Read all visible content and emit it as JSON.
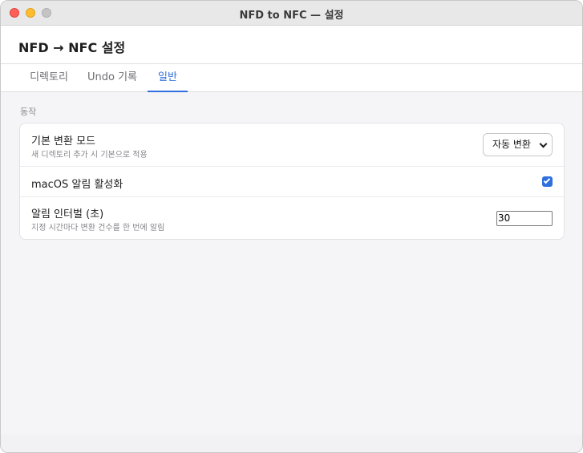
{
  "window": {
    "title": "NFD to NFC — 설정"
  },
  "header": {
    "title": "NFD → NFC 설정"
  },
  "tabs": [
    {
      "label": "디렉토리",
      "active": false
    },
    {
      "label": "Undo 기록",
      "active": false
    },
    {
      "label": "일반",
      "active": true
    }
  ],
  "section": {
    "label": "동작"
  },
  "settings": {
    "default_mode": {
      "title": "기본 변환 모드",
      "description": "새 디렉토리 추가 시 기본으로 적용",
      "selected": "자동 변환"
    },
    "notifications": {
      "title": "macOS 알림 활성화",
      "checked": true
    },
    "interval": {
      "title": "알림 인터벌 (초)",
      "description": "지정 시간마다 변환 건수를 한 번에 알림",
      "value": "30"
    }
  },
  "colors": {
    "accent": "#2f6fde"
  }
}
